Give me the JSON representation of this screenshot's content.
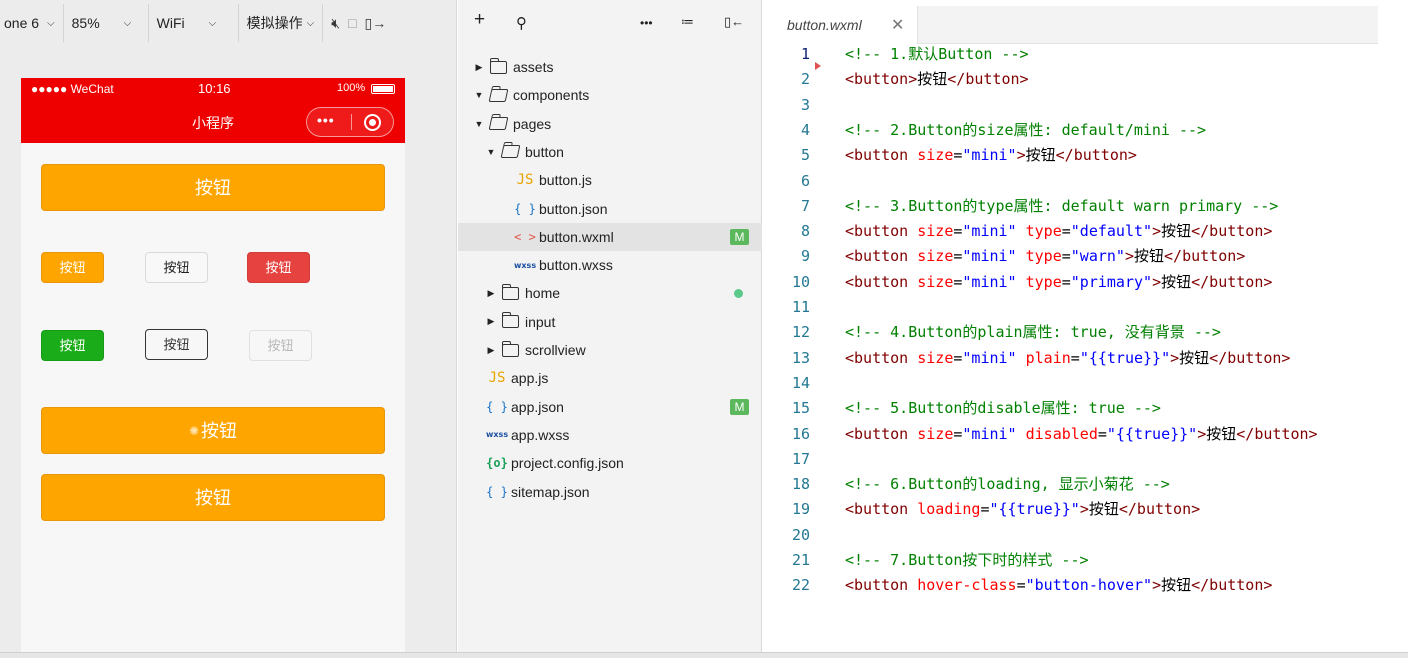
{
  "simulator": {
    "toolbar": {
      "device": "one 6",
      "zoom": "85%",
      "network": "WiFi",
      "operation": "模拟操作",
      "icons": [
        "mute-icon",
        "screen-icon",
        "detach-icon"
      ]
    },
    "status_bar": {
      "carrier": "●●●●● WeChat",
      "time": "10:16",
      "battery": "100%"
    },
    "nav_title": "小程序",
    "buttons": {
      "default_big": "按钮",
      "mini_default": "按钮",
      "mini_default_gray": "按钮",
      "mini_warn": "按钮",
      "mini_primary": "按钮",
      "mini_plain": "按钮",
      "mini_disabled": "按钮",
      "loading": "按钮",
      "hover": "按钮"
    }
  },
  "explorer": {
    "toolbar_icons": [
      "add-icon",
      "search-icon",
      "more-icon",
      "collapse-icon",
      "split-icon"
    ],
    "items": [
      {
        "label": "assets",
        "type": "folder",
        "expanded": false,
        "depth": 0
      },
      {
        "label": "components",
        "type": "folder",
        "expanded": true,
        "depth": 0
      },
      {
        "label": "pages",
        "type": "folder",
        "expanded": true,
        "depth": 0
      },
      {
        "label": "button",
        "type": "folder",
        "expanded": true,
        "depth": 1
      },
      {
        "label": "button.js",
        "type": "js",
        "depth": 2
      },
      {
        "label": "button.json",
        "type": "json",
        "depth": 2
      },
      {
        "label": "button.wxml",
        "type": "wxml",
        "depth": 2,
        "selected": true,
        "badge": "M"
      },
      {
        "label": "button.wxss",
        "type": "wxss",
        "depth": 2
      },
      {
        "label": "home",
        "type": "folder",
        "expanded": false,
        "depth": 1,
        "modified_dot": true
      },
      {
        "label": "input",
        "type": "folder",
        "expanded": false,
        "depth": 1
      },
      {
        "label": "scrollview",
        "type": "folder",
        "expanded": false,
        "depth": 1
      },
      {
        "label": "app.js",
        "type": "js",
        "depth": 0
      },
      {
        "label": "app.json",
        "type": "json",
        "depth": 0,
        "badge": "M"
      },
      {
        "label": "app.wxss",
        "type": "wxss",
        "depth": 0
      },
      {
        "label": "project.config.json",
        "type": "config",
        "depth": 0
      },
      {
        "label": "sitemap.json",
        "type": "json",
        "depth": 0
      }
    ],
    "icon_glyphs": {
      "js": "JS",
      "json": "{ }",
      "wxml": "< >",
      "wxss": "wxss",
      "config": "{o}"
    }
  },
  "editor": {
    "tab_name": "button.wxml",
    "current_line": 1,
    "lines": [
      "<!-- 1.默认Button -->",
      "<button>按钮</button>",
      "",
      "<!-- 2.Button的size属性: default/mini -->",
      "<button size=\"mini\">按钮</button>",
      "",
      "<!-- 3.Button的type属性: default warn primary -->",
      "<button size=\"mini\" type=\"default\">按钮</button>",
      "<button size=\"mini\" type=\"warn\">按钮</button>",
      "<button size=\"mini\" type=\"primary\">按钮</button>",
      "",
      "<!-- 4.Button的plain属性: true, 没有背景 -->",
      "<button size=\"mini\" plain=\"{{true}}\">按钮</button>",
      "",
      "<!-- 5.Button的disable属性: true -->",
      "<button size=\"mini\" disabled=\"{{true}}\">按钮</button>",
      "",
      "<!-- 6.Button的loading, 显示小菊花 -->",
      "<button loading=\"{{true}}\">按钮</button>",
      "",
      "<!-- 7.Button按下时的样式 -->",
      "<button hover-class=\"button-hover\">按钮</button>"
    ]
  },
  "colors": {
    "wechat_red": "#ee0000",
    "button_orange": "#ffa500",
    "warn_red": "#e64340",
    "primary_green": "#1aad19",
    "comment_green": "#008000",
    "tag_maroon": "#800000",
    "attr_red": "#ff0000",
    "value_blue": "#0000ff",
    "line_number": "#237893",
    "modified_badge": "#5cb85c"
  }
}
